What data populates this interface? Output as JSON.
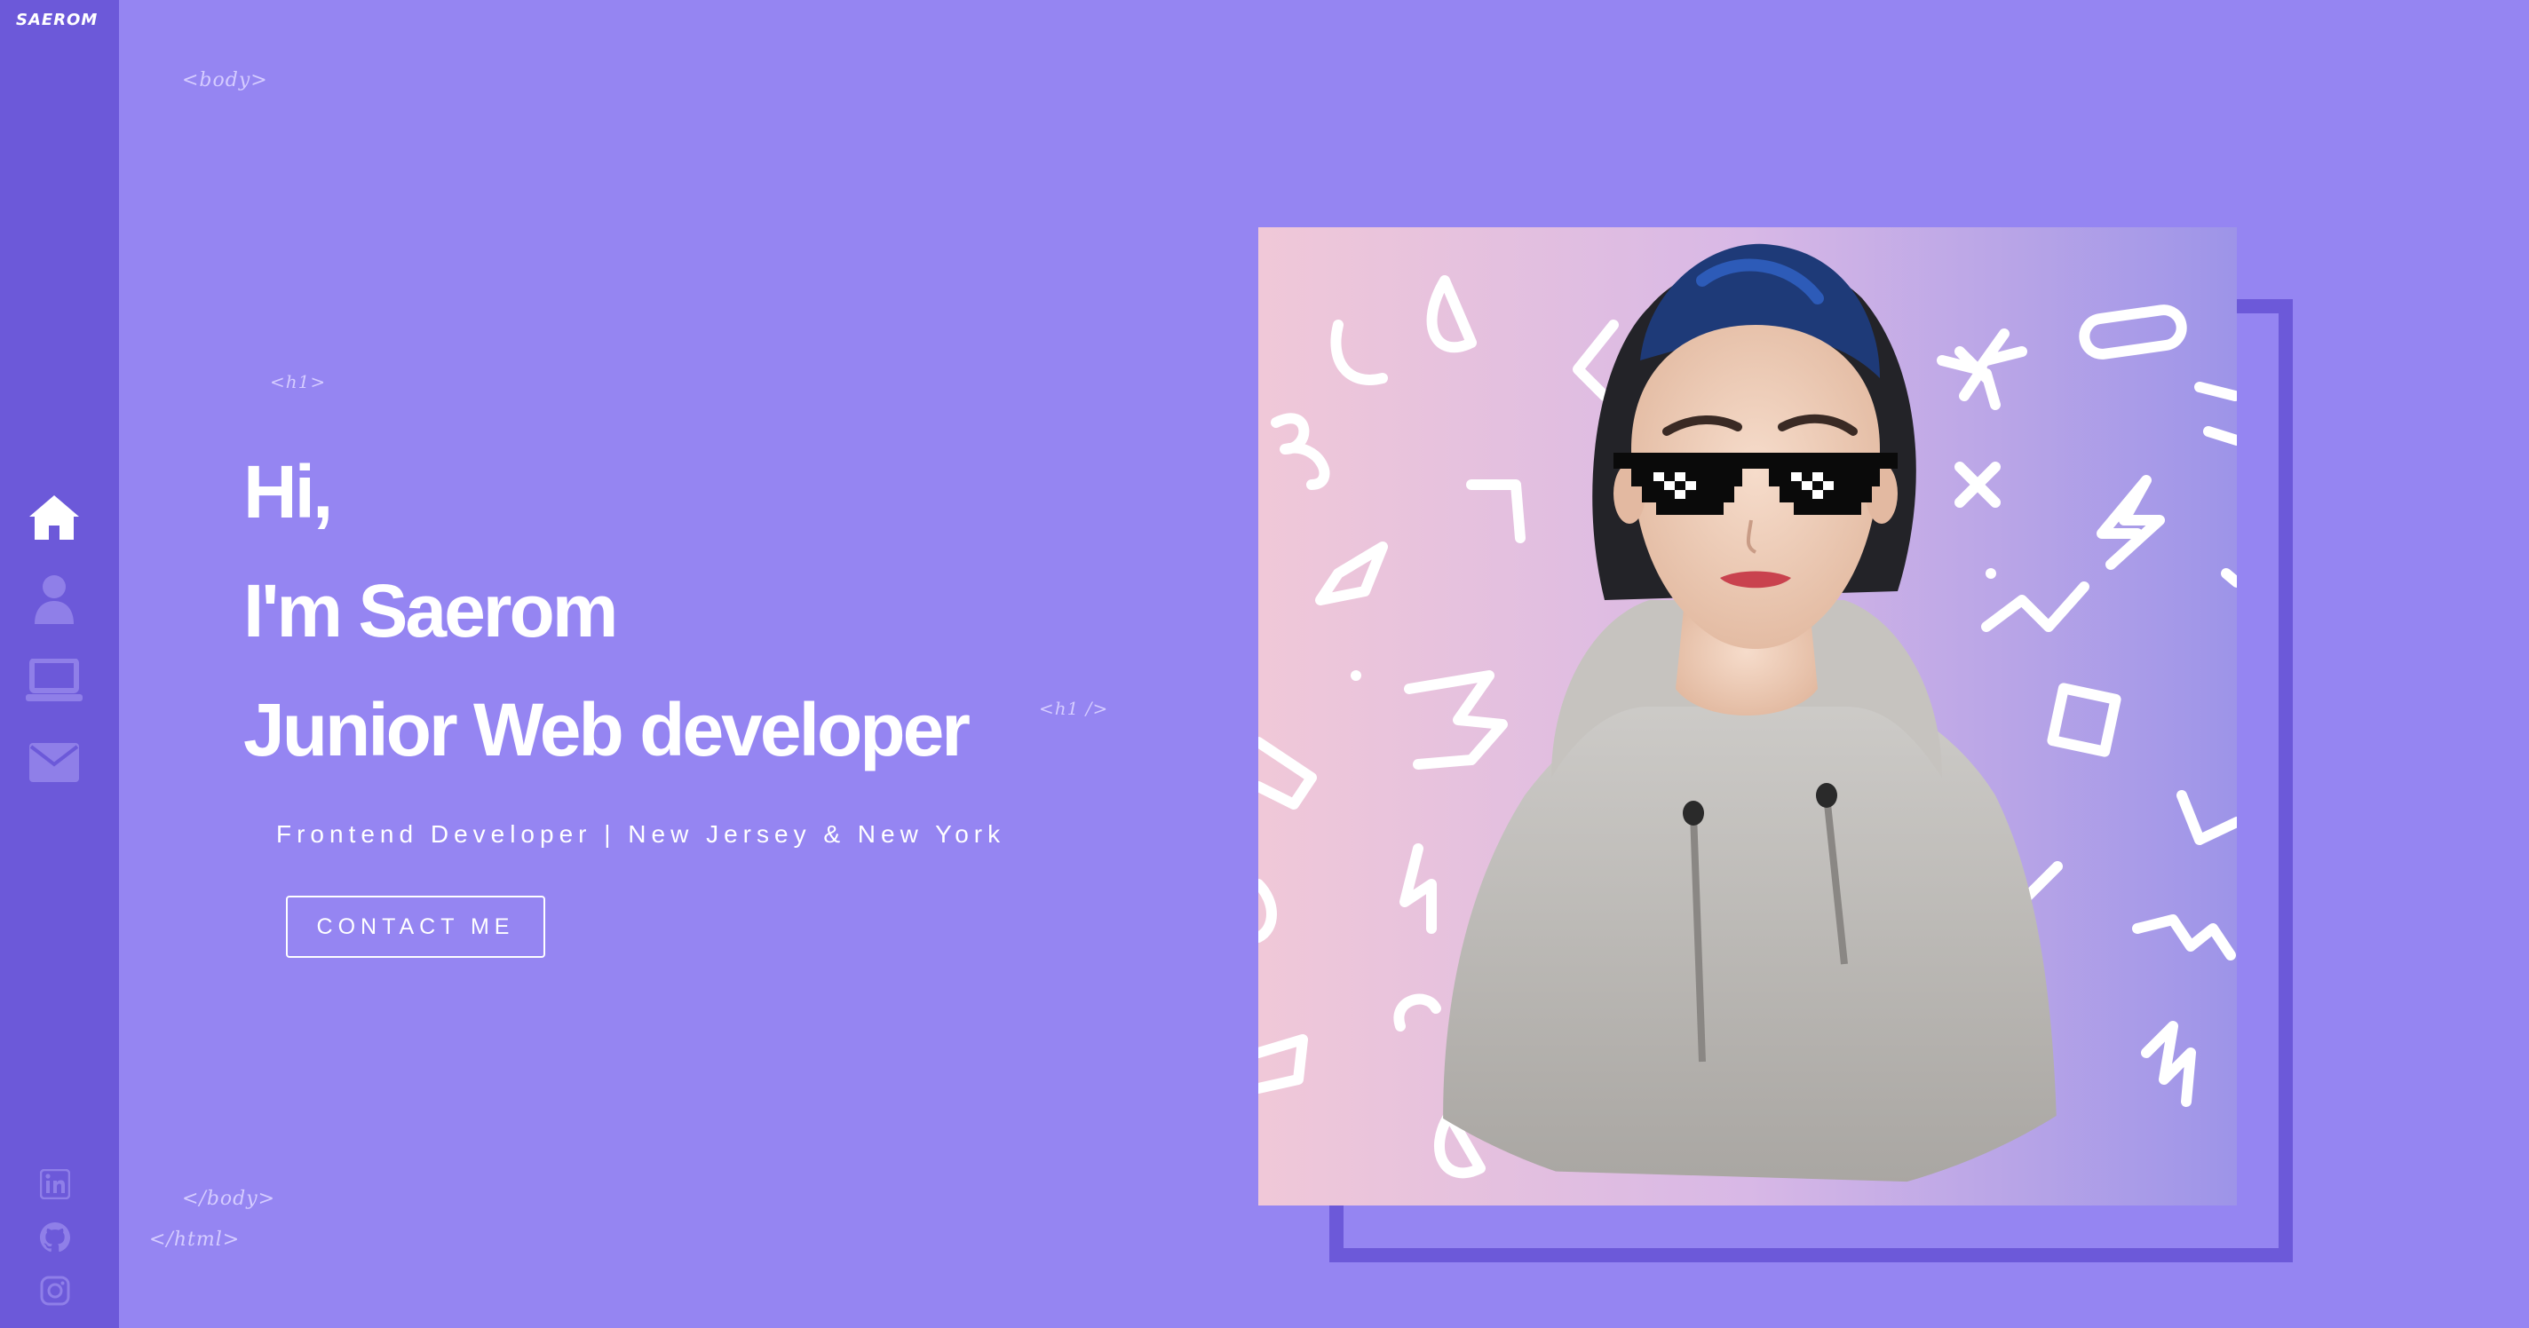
{
  "sidebar": {
    "logo": "SAEROM",
    "nav": [
      {
        "name": "home",
        "icon": "home-icon",
        "active": true
      },
      {
        "name": "about",
        "icon": "user-icon",
        "active": false
      },
      {
        "name": "projects",
        "icon": "laptop-icon",
        "active": false
      },
      {
        "name": "contact",
        "icon": "envelope-icon",
        "active": false
      }
    ],
    "social": [
      {
        "name": "linkedin",
        "icon": "linkedin-icon"
      },
      {
        "name": "github",
        "icon": "github-icon"
      },
      {
        "name": "instagram",
        "icon": "instagram-icon"
      }
    ]
  },
  "tags": {
    "body_open": "<body>",
    "h1_open": "<h1>",
    "h1_close": "<h1 />",
    "body_close": "</body>",
    "html_close": "</html>"
  },
  "hero": {
    "line1": "Hi,",
    "line2": "I'm Saerom",
    "line3": "Junior Web developer",
    "subtitle": "Frontend Developer | New Jersey & New York",
    "contact_label": "CONTACT ME"
  },
  "colors": {
    "background": "#9585f2",
    "sidebar": "#6c59d9",
    "accent": "#6c59d9",
    "text": "#ffffff"
  }
}
